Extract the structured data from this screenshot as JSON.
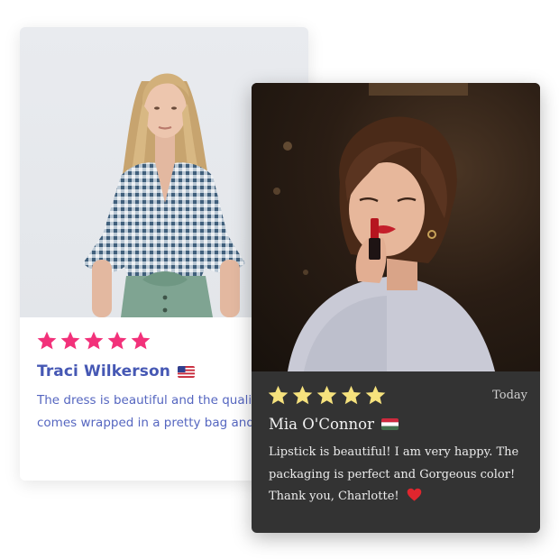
{
  "reviews": [
    {
      "name": "Traci Wilkerson",
      "flag": "us-flag-icon",
      "rating": 5,
      "text": "The dress is beautiful and the quality is great, it comes wrapped in a pretty bag and I like it!",
      "colors": {
        "star": "#f2317a",
        "name": "#4658b4",
        "text": "#5566c0"
      }
    },
    {
      "name": "Mia O'Connor",
      "flag": "hungary-flag-icon",
      "rating": 5,
      "date": "Today",
      "text": "Lipstick is beautiful! I am very happy. The packaging is perfect and Gorgeous color! Thank you, Charlotte!",
      "heart": "heart-icon",
      "colors": {
        "star": "#f6e27d",
        "card": "#333333",
        "text": "#ececec"
      }
    }
  ]
}
